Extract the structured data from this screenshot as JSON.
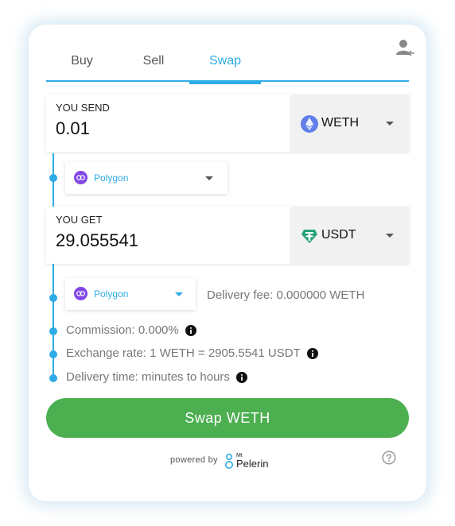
{
  "tabs": [
    {
      "label": "Buy"
    },
    {
      "label": "Sell"
    },
    {
      "label": "Swap",
      "active": true
    }
  ],
  "send": {
    "label": "YOU SEND",
    "amount": "0.01",
    "token": "WETH",
    "token_icon": "ethereum-icon",
    "network": "Polygon",
    "network_icon": "polygon-icon"
  },
  "get": {
    "label": "YOU GET",
    "amount": "29.055541",
    "token": "USDT",
    "token_icon": "tether-icon",
    "network": "Polygon",
    "network_icon": "polygon-icon"
  },
  "details": {
    "delivery_fee": "Delivery fee: 0.000000 WETH",
    "commission": "Commission: 0.000%",
    "exchange_rate": "Exchange rate: 1 WETH = 2905.5541 USDT",
    "delivery_time": "Delivery time: minutes to hours"
  },
  "action": {
    "swap_label": "Swap WETH"
  },
  "footer": {
    "powered_by": "powered by",
    "logo_top": "Mt",
    "logo_name": "Pelerin"
  },
  "colors": {
    "accent": "#2dace6",
    "button": "#4caf50",
    "polygon": "#8247e5",
    "ethereum": "#627eea",
    "tether": "#26a17b"
  }
}
